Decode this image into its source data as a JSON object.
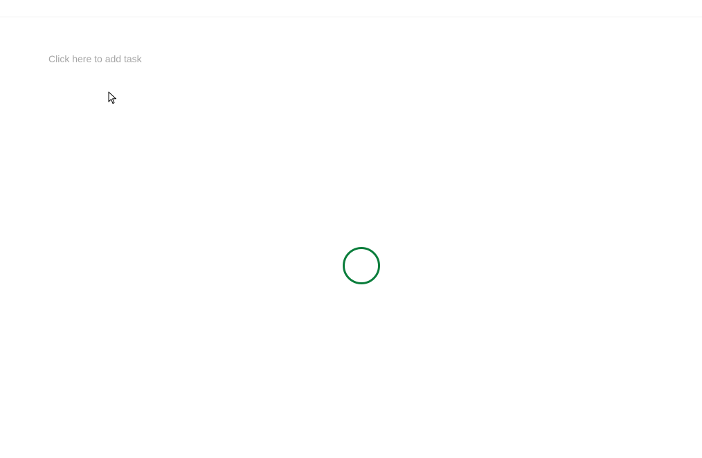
{
  "task_input": {
    "placeholder": "Click here to add task"
  },
  "loading": {
    "icon": "loading-spinner-icon",
    "color": "#0a7d3b"
  },
  "colors": {
    "background": "#ffffff",
    "placeholder_text": "#a6a6a6",
    "divider": "#f0f0f0"
  }
}
